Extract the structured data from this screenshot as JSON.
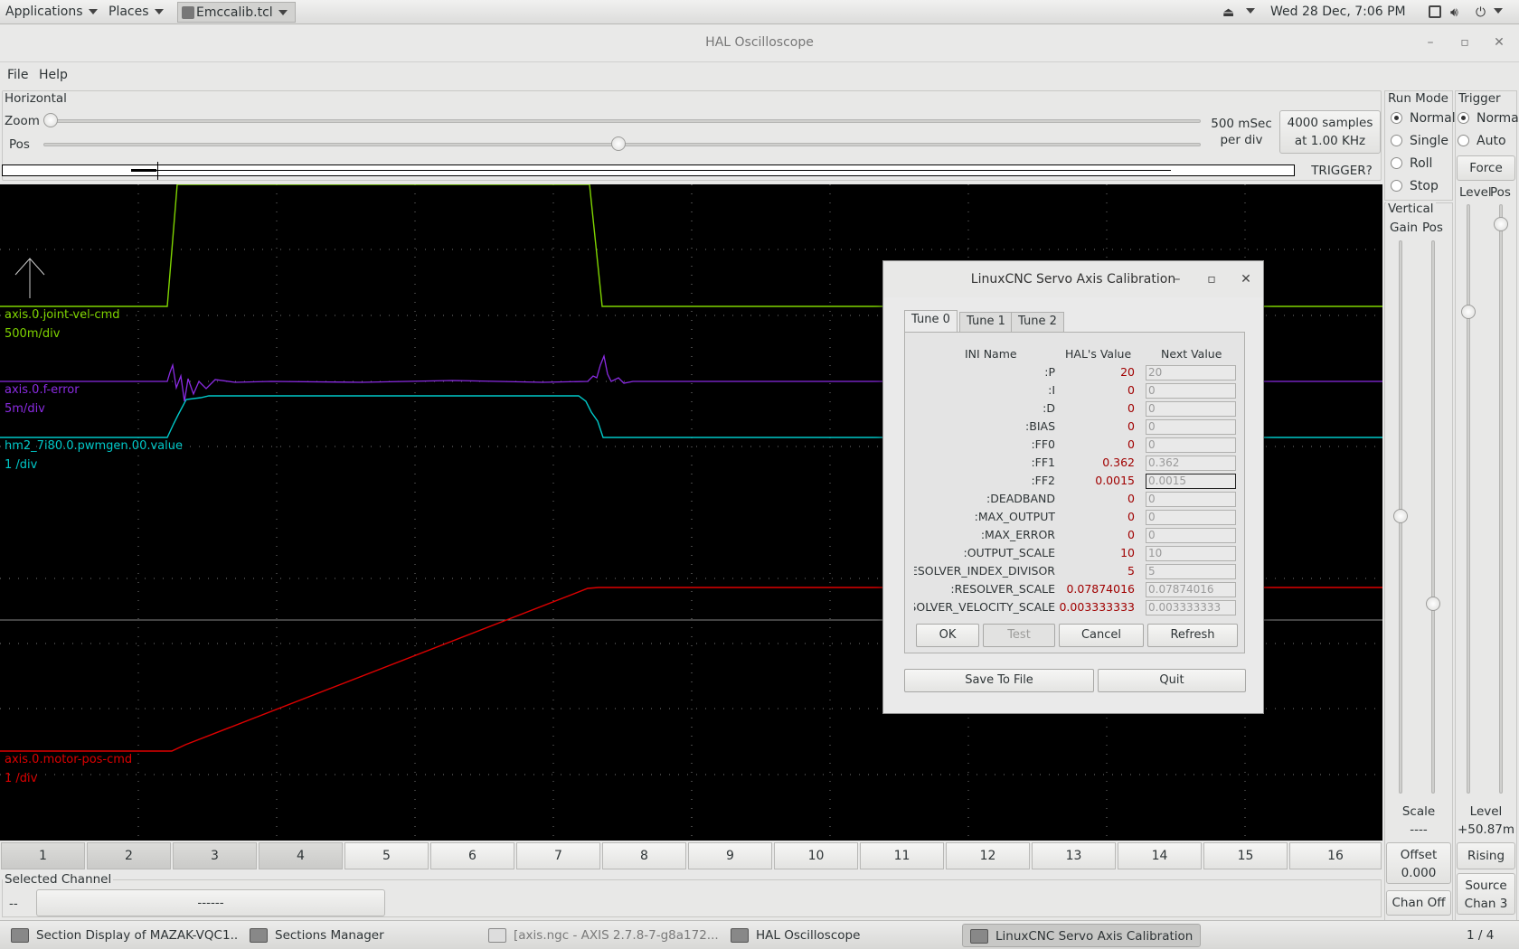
{
  "top_panel": {
    "applications": "Applications",
    "places": "Places",
    "active_app": "Emccalib.tcl",
    "clock": "Wed 28 Dec,  7:06 PM"
  },
  "window": {
    "title": "HAL Oscilloscope"
  },
  "menu": {
    "file": "File",
    "help": "Help"
  },
  "horizontal": {
    "label": "Horizontal",
    "zoom_label": "Zoom",
    "pos_label": "Pos",
    "rate_line1": "500 mSec",
    "rate_line2": "per div",
    "samples_line1": "4000 samples",
    "samples_line2": "at 1.00 KHz",
    "trigger_status": "TRIGGER?"
  },
  "signals": [
    {
      "name": "axis.0.joint-vel-cmd",
      "scale": "500m/div",
      "color": "#7fd400"
    },
    {
      "name": "axis.0.f-error",
      "scale": "5m/div",
      "color": "#8a2be2"
    },
    {
      "name": "hm2_7i80.0.pwmgen.00.value",
      "scale": "1 /div",
      "color": "#00c8c8"
    },
    {
      "name": "axis.0.motor-pos-cmd",
      "scale": "1 /div",
      "color": "#dd0000"
    }
  ],
  "run_mode": {
    "label": "Run Mode",
    "options": [
      "Normal",
      "Single",
      "Roll",
      "Stop"
    ],
    "selected": "Normal"
  },
  "trigger": {
    "label": "Trigger",
    "options": [
      "Normal",
      "Auto"
    ],
    "selected": "Normal",
    "force": "Force",
    "level_label": "Level",
    "pos_label": "Pos",
    "level_caption": "Level",
    "level_value": "+50.87m",
    "rising": "Rising",
    "source_line1": "Source",
    "source_line2": "Chan  3"
  },
  "vertical": {
    "label": "Vertical",
    "gain_label": "Gain",
    "pos_label": "Pos",
    "scale_label": "Scale",
    "scale_value": "----",
    "offset_line1": "Offset",
    "offset_line2": "0.000",
    "chan_off": "Chan Off"
  },
  "channels": [
    "1",
    "2",
    "3",
    "4",
    "5",
    "6",
    "7",
    "8",
    "9",
    "10",
    "11",
    "12",
    "13",
    "14",
    "15",
    "16"
  ],
  "selected_channel": {
    "label": "Selected Channel",
    "number": "--",
    "name": "------"
  },
  "page_indicator": "1 / 4",
  "taskbar": [
    {
      "label": "Section Display of MAZAK-VQC1..."
    },
    {
      "label": "Sections Manager"
    },
    {
      "label": "[axis.ngc - AXIS 2.7.8-7-g8a172..."
    },
    {
      "label": "HAL Oscilloscope"
    },
    {
      "label": "LinuxCNC Servo Axis Calibration"
    }
  ],
  "dialog": {
    "title": "LinuxCNC Servo Axis Calibration",
    "tabs": [
      "Tune 0",
      "Tune 1",
      "Tune 2"
    ],
    "col_ini": "INI Name",
    "col_hal": "HAL's Value",
    "col_next": "Next Value",
    "rows": [
      {
        "name": "P:",
        "hal": "20",
        "next": "20"
      },
      {
        "name": "I:",
        "hal": "0",
        "next": "0"
      },
      {
        "name": "D:",
        "hal": "0",
        "next": "0"
      },
      {
        "name": "BIAS:",
        "hal": "0",
        "next": "0"
      },
      {
        "name": "FF0:",
        "hal": "0",
        "next": "0"
      },
      {
        "name": "FF1:",
        "hal": "0.362",
        "next": "0.362"
      },
      {
        "name": "FF2:",
        "hal": "0.0015",
        "next": "0.0015"
      },
      {
        "name": "DEADBAND:",
        "hal": "0",
        "next": "0"
      },
      {
        "name": "MAX_OUTPUT:",
        "hal": "0",
        "next": "0"
      },
      {
        "name": "MAX_ERROR:",
        "hal": "0",
        "next": "0"
      },
      {
        "name": "OUTPUT_SCALE:",
        "hal": "10",
        "next": "10"
      },
      {
        "name": "RESOLVER_INDEX_DIVISOR:",
        "hal": "5",
        "next": "5"
      },
      {
        "name": "RESOLVER_SCALE:",
        "hal": "0.07874016",
        "next": "0.07874016"
      },
      {
        "name": "RESOLVER_VELOCITY_SCALE:",
        "hal": "0.003333333",
        "next": "0.003333333"
      }
    ],
    "ok": "OK",
    "test": "Test",
    "cancel": "Cancel",
    "refresh": "Refresh",
    "save": "Save To File",
    "quit": "Quit"
  }
}
